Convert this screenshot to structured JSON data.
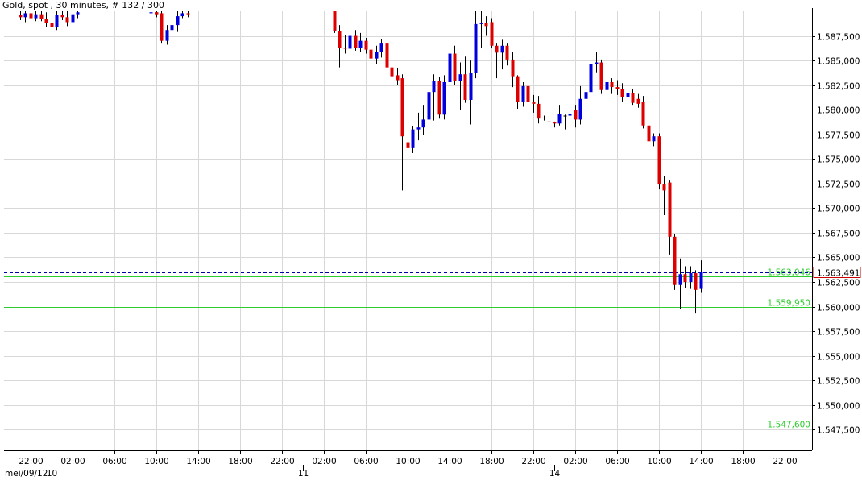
{
  "header": {
    "title": "Gold, spot , 30 minutes, # 132 / 300"
  },
  "colors": {
    "bull": "#0000dd",
    "bear": "#dd0000",
    "grid": "#d8d8d8",
    "level_line": "#2ecc2e",
    "level_label": "#2ecc2e",
    "current_line": "#0000aa",
    "current_badge_border": "#cc0000",
    "axis_text": "#000000"
  },
  "chart_data": {
    "type": "candlestick",
    "title": "Gold, spot , 30 minutes, # 132 / 300",
    "timeframe": "30 minutes",
    "ylim": [
      1545400,
      1590000
    ],
    "y_ticks": [
      "1.547,500",
      "1.550,000",
      "1.552,500",
      "1.555,000",
      "1.557,500",
      "1.560,000",
      "1.562,500",
      "1.565,000",
      "1.567,500",
      "1.570,000",
      "1.572,500",
      "1.575,000",
      "1.577,500",
      "1.580,000",
      "1.582,500",
      "1.585,000",
      "1.587,500"
    ],
    "x_ticks": [
      "22:00",
      "02:00",
      "06:00",
      "10:00",
      "14:00",
      "18:00",
      "22:00",
      "02:00",
      "06:00",
      "10:00",
      "14:00",
      "18:00",
      "22:00",
      "02:00",
      "06:00",
      "10:00",
      "14:00",
      "18:00",
      "22:00"
    ],
    "date_labels": [
      "mei/09/12",
      "10",
      "11",
      "14"
    ],
    "grid": true,
    "horizontal_levels": [
      {
        "label": "1.563,046",
        "value": 1563046
      },
      {
        "label": "1.559,950",
        "value": 1559950
      },
      {
        "label": "1.547,600",
        "value": 1547600
      }
    ],
    "current_price": {
      "label": "1.563,491",
      "value": 1563491
    },
    "candles": [
      {
        "t": "mei/09 21:00",
        "o": 1589600,
        "h": 1590000,
        "l": 1589100,
        "c": 1589400
      },
      {
        "t": "mei/09 21:30",
        "o": 1589400,
        "h": 1590000,
        "l": 1588900,
        "c": 1589800
      },
      {
        "t": "mei/09 22:00",
        "o": 1589800,
        "h": 1590000,
        "l": 1589100,
        "c": 1589300
      },
      {
        "t": "mei/09 22:30",
        "o": 1589300,
        "h": 1590000,
        "l": 1589000,
        "c": 1589700
      },
      {
        "t": "mei/09 23:00",
        "o": 1589700,
        "h": 1590000,
        "l": 1589000,
        "c": 1589200
      },
      {
        "t": "mei/09 23:30",
        "o": 1589200,
        "h": 1589900,
        "l": 1588400,
        "c": 1588800
      },
      {
        "t": "mei/10 00:00",
        "o": 1588800,
        "h": 1589600,
        "l": 1588200,
        "c": 1588400
      },
      {
        "t": "mei/10 00:30",
        "o": 1588400,
        "h": 1590000,
        "l": 1588100,
        "c": 1589600
      },
      {
        "t": "mei/10 01:00",
        "o": 1589600,
        "h": 1590000,
        "l": 1589100,
        "c": 1589400
      },
      {
        "t": "mei/10 01:30",
        "o": 1589400,
        "h": 1590000,
        "l": 1588500,
        "c": 1588900
      },
      {
        "t": "mei/10 02:00",
        "o": 1588900,
        "h": 1590000,
        "l": 1588700,
        "c": 1589700
      },
      {
        "t": "mei/10 02:30",
        "o": 1589700,
        "h": 1590000,
        "l": 1589300,
        "c": 1589900
      },
      {
        "t": "mei/10 09:30",
        "o": 1589800,
        "h": 1590000,
        "l": 1589500,
        "c": 1589900
      },
      {
        "t": "mei/10 10:00",
        "o": 1589900,
        "h": 1590000,
        "l": 1589400,
        "c": 1589700
      },
      {
        "t": "mei/10 10:30",
        "o": 1589800,
        "h": 1590000,
        "l": 1586800,
        "c": 1587000
      },
      {
        "t": "mei/10 11:00",
        "o": 1587000,
        "h": 1588600,
        "l": 1586600,
        "c": 1588100
      },
      {
        "t": "mei/10 11:30",
        "o": 1588100,
        "h": 1590000,
        "l": 1585600,
        "c": 1588600
      },
      {
        "t": "mei/10 12:00",
        "o": 1588600,
        "h": 1590000,
        "l": 1587900,
        "c": 1589500
      },
      {
        "t": "mei/10 12:30",
        "o": 1589500,
        "h": 1590000,
        "l": 1589300,
        "c": 1589800
      },
      {
        "t": "mei/10 13:00",
        "o": 1589800,
        "h": 1590000,
        "l": 1589400,
        "c": 1589700
      },
      {
        "t": "mei/11 03:00",
        "o": 1590000,
        "h": 1590000,
        "l": 1587800,
        "c": 1588000
      },
      {
        "t": "mei/11 03:30",
        "o": 1588000,
        "h": 1588600,
        "l": 1584300,
        "c": 1586300
      },
      {
        "t": "mei/11 04:00",
        "o": 1586300,
        "h": 1587600,
        "l": 1585700,
        "c": 1586200
      },
      {
        "t": "mei/11 04:30",
        "o": 1586200,
        "h": 1588300,
        "l": 1585800,
        "c": 1587500
      },
      {
        "t": "mei/11 05:00",
        "o": 1587500,
        "h": 1588100,
        "l": 1586000,
        "c": 1586300
      },
      {
        "t": "mei/11 05:30",
        "o": 1586300,
        "h": 1587800,
        "l": 1585900,
        "c": 1587000
      },
      {
        "t": "mei/11 06:00",
        "o": 1587000,
        "h": 1587300,
        "l": 1585700,
        "c": 1586100
      },
      {
        "t": "mei/11 06:30",
        "o": 1586100,
        "h": 1586800,
        "l": 1584800,
        "c": 1585200
      },
      {
        "t": "mei/11 07:00",
        "o": 1585200,
        "h": 1586500,
        "l": 1584600,
        "c": 1585900
      },
      {
        "t": "mei/11 07:30",
        "o": 1585900,
        "h": 1587200,
        "l": 1585300,
        "c": 1586800
      },
      {
        "t": "mei/11 08:00",
        "o": 1586800,
        "h": 1587200,
        "l": 1583500,
        "c": 1584300
      },
      {
        "t": "mei/11 08:30",
        "o": 1584300,
        "h": 1584800,
        "l": 1582000,
        "c": 1583400
      },
      {
        "t": "mei/11 09:00",
        "o": 1583500,
        "h": 1584200,
        "l": 1582500,
        "c": 1583000
      },
      {
        "t": "mei/11 09:30",
        "o": 1583200,
        "h": 1583600,
        "l": 1571800,
        "c": 1577300
      },
      {
        "t": "mei/11 10:00",
        "o": 1576700,
        "h": 1577600,
        "l": 1575500,
        "c": 1576100
      },
      {
        "t": "mei/11 10:30",
        "o": 1576100,
        "h": 1578300,
        "l": 1575600,
        "c": 1578000
      },
      {
        "t": "mei/11 11:00",
        "o": 1578000,
        "h": 1579700,
        "l": 1576900,
        "c": 1578200
      },
      {
        "t": "mei/11 11:30",
        "o": 1578200,
        "h": 1580500,
        "l": 1577400,
        "c": 1579000
      },
      {
        "t": "mei/11 12:00",
        "o": 1579000,
        "h": 1583500,
        "l": 1578200,
        "c": 1581800
      },
      {
        "t": "mei/11 12:30",
        "o": 1581800,
        "h": 1583600,
        "l": 1578900,
        "c": 1582900
      },
      {
        "t": "mei/11 13:00",
        "o": 1582900,
        "h": 1583300,
        "l": 1579100,
        "c": 1579500
      },
      {
        "t": "mei/11 13:30",
        "o": 1579500,
        "h": 1583500,
        "l": 1579000,
        "c": 1582800
      },
      {
        "t": "mei/11 14:00",
        "o": 1582800,
        "h": 1586300,
        "l": 1582100,
        "c": 1585700
      },
      {
        "t": "mei/11 14:30",
        "o": 1585700,
        "h": 1586500,
        "l": 1582500,
        "c": 1582900
      },
      {
        "t": "mei/11 15:00",
        "o": 1582900,
        "h": 1584800,
        "l": 1580000,
        "c": 1583600
      },
      {
        "t": "mei/11 15:30",
        "o": 1583600,
        "h": 1585400,
        "l": 1580700,
        "c": 1581000
      },
      {
        "t": "mei/11 16:00",
        "o": 1581000,
        "h": 1585000,
        "l": 1578500,
        "c": 1583700
      },
      {
        "t": "mei/11 16:30",
        "o": 1583700,
        "h": 1590000,
        "l": 1583200,
        "c": 1588700
      },
      {
        "t": "mei/11 17:00",
        "o": 1588700,
        "h": 1590000,
        "l": 1586300,
        "c": 1588800
      },
      {
        "t": "mei/11 17:30",
        "o": 1588800,
        "h": 1589500,
        "l": 1587500,
        "c": 1588500
      },
      {
        "t": "mei/11 18:00",
        "o": 1588900,
        "h": 1589300,
        "l": 1586300,
        "c": 1586500
      },
      {
        "t": "mei/11 18:30",
        "o": 1586500,
        "h": 1586800,
        "l": 1583200,
        "c": 1585800
      },
      {
        "t": "mei/11 19:00",
        "o": 1585800,
        "h": 1587100,
        "l": 1584100,
        "c": 1586500
      },
      {
        "t": "mei/11 19:30",
        "o": 1586500,
        "h": 1586800,
        "l": 1584500,
        "c": 1585100
      },
      {
        "t": "mei/11 20:00",
        "o": 1585100,
        "h": 1585900,
        "l": 1582300,
        "c": 1583400
      },
      {
        "t": "mei/11 20:30",
        "o": 1583400,
        "h": 1583500,
        "l": 1580100,
        "c": 1580800
      },
      {
        "t": "mei/11 21:00",
        "o": 1580800,
        "h": 1582800,
        "l": 1580300,
        "c": 1582400
      },
      {
        "t": "mei/11 21:30",
        "o": 1582400,
        "h": 1582700,
        "l": 1580000,
        "c": 1580800
      },
      {
        "t": "mei/11 22:00",
        "o": 1580800,
        "h": 1581500,
        "l": 1579700,
        "c": 1580600
      },
      {
        "t": "mei/11 22:30",
        "o": 1580600,
        "h": 1581400,
        "l": 1578600,
        "c": 1579100
      },
      {
        "t": "mei/11 23:00",
        "o": 1579200,
        "h": 1579400,
        "l": 1578900,
        "c": 1579200
      },
      {
        "t": "mei/11 23:30",
        "o": 1578800,
        "h": 1578900,
        "l": 1578400,
        "c": 1578800
      },
      {
        "t": "mei/14 00:00",
        "o": 1578700,
        "h": 1578800,
        "l": 1578200,
        "c": 1578600
      },
      {
        "t": "mei/14 00:30",
        "o": 1578600,
        "h": 1580500,
        "l": 1578400,
        "c": 1579600
      },
      {
        "t": "mei/14 01:00",
        "o": 1579400,
        "h": 1579500,
        "l": 1578000,
        "c": 1579400
      },
      {
        "t": "mei/14 01:30",
        "o": 1579400,
        "h": 1585000,
        "l": 1578300,
        "c": 1579600
      },
      {
        "t": "mei/14 02:00",
        "o": 1580000,
        "h": 1580500,
        "l": 1578200,
        "c": 1579000
      },
      {
        "t": "mei/14 02:30",
        "o": 1579000,
        "h": 1582400,
        "l": 1578500,
        "c": 1581100
      },
      {
        "t": "mei/14 03:00",
        "o": 1581100,
        "h": 1582600,
        "l": 1579700,
        "c": 1581800
      },
      {
        "t": "mei/14 03:30",
        "o": 1581800,
        "h": 1585400,
        "l": 1580600,
        "c": 1584600
      },
      {
        "t": "mei/14 04:00",
        "o": 1584600,
        "h": 1585900,
        "l": 1583800,
        "c": 1584800
      },
      {
        "t": "mei/14 04:30",
        "o": 1584800,
        "h": 1585100,
        "l": 1581600,
        "c": 1582000
      },
      {
        "t": "mei/14 05:00",
        "o": 1582000,
        "h": 1583700,
        "l": 1581200,
        "c": 1582800
      },
      {
        "t": "mei/14 05:30",
        "o": 1582800,
        "h": 1583200,
        "l": 1581600,
        "c": 1582300
      },
      {
        "t": "mei/14 06:00",
        "o": 1582300,
        "h": 1583000,
        "l": 1581500,
        "c": 1582100
      },
      {
        "t": "mei/14 06:30",
        "o": 1582100,
        "h": 1582700,
        "l": 1580800,
        "c": 1581300
      },
      {
        "t": "mei/14 07:00",
        "o": 1581300,
        "h": 1582200,
        "l": 1580600,
        "c": 1581700
      },
      {
        "t": "mei/14 07:30",
        "o": 1581700,
        "h": 1582100,
        "l": 1580500,
        "c": 1580700
      },
      {
        "t": "mei/14 08:00",
        "o": 1581100,
        "h": 1581600,
        "l": 1580200,
        "c": 1580600
      },
      {
        "t": "mei/14 08:30",
        "o": 1580800,
        "h": 1581400,
        "l": 1578100,
        "c": 1578400
      },
      {
        "t": "mei/14 09:00",
        "o": 1578400,
        "h": 1579300,
        "l": 1576000,
        "c": 1576800
      },
      {
        "t": "mei/14 09:30",
        "o": 1576800,
        "h": 1577600,
        "l": 1576300,
        "c": 1577300
      },
      {
        "t": "mei/14 10:00",
        "o": 1577300,
        "h": 1577600,
        "l": 1571900,
        "c": 1572400
      },
      {
        "t": "mei/14 10:30",
        "o": 1572400,
        "h": 1573300,
        "l": 1569300,
        "c": 1571800
      },
      {
        "t": "mei/14 11:00",
        "o": 1572600,
        "h": 1572800,
        "l": 1565300,
        "c": 1567100
      },
      {
        "t": "mei/14 11:30",
        "o": 1567100,
        "h": 1567400,
        "l": 1561700,
        "c": 1562200
      },
      {
        "t": "mei/14 12:00",
        "o": 1562200,
        "h": 1564900,
        "l": 1559800,
        "c": 1563300
      },
      {
        "t": "mei/14 12:30",
        "o": 1563300,
        "h": 1564100,
        "l": 1561900,
        "c": 1562500
      },
      {
        "t": "mei/14 13:00",
        "o": 1562500,
        "h": 1564100,
        "l": 1561800,
        "c": 1563400
      },
      {
        "t": "mei/14 13:30",
        "o": 1563400,
        "h": 1563700,
        "l": 1559300,
        "c": 1561700
      },
      {
        "t": "mei/14 14:00",
        "o": 1561800,
        "h": 1564700,
        "l": 1561400,
        "c": 1563500
      }
    ]
  }
}
